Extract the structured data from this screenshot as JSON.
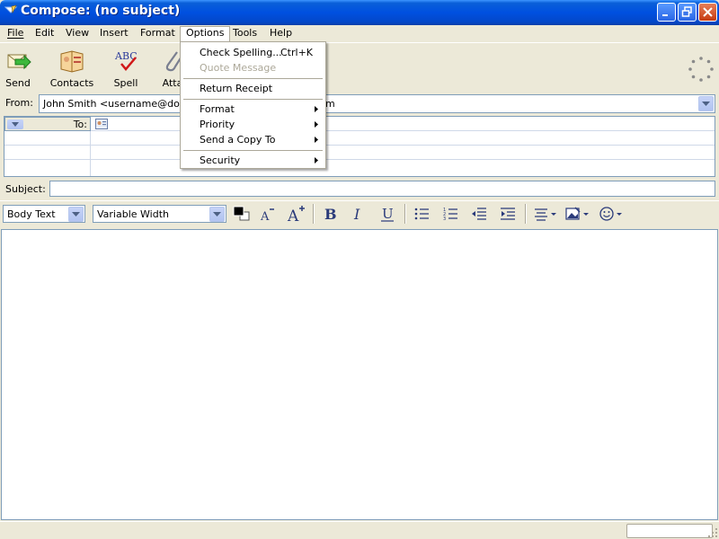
{
  "window": {
    "title": "Compose: (no subject)"
  },
  "menubar": {
    "items": [
      {
        "label": "File",
        "key": "F"
      },
      {
        "label": "Edit",
        "key": "E"
      },
      {
        "label": "View",
        "key": "V"
      },
      {
        "label": "Insert",
        "key": "I"
      },
      {
        "label": "Format",
        "key": "o"
      },
      {
        "label": "Options",
        "key": "p",
        "open": true
      },
      {
        "label": "Tools",
        "key": "T"
      },
      {
        "label": "Help",
        "key": "H"
      }
    ]
  },
  "toolbar": {
    "send_label": "Send",
    "contacts_label": "Contacts",
    "spell_label": "Spell",
    "attach_label": "Atta"
  },
  "options_menu": {
    "check_spelling": "Check Spelling...",
    "check_spelling_shortcut": "Ctrl+K",
    "quote_message": "Quote Message",
    "return_receipt": "Return Receipt",
    "format": "Format",
    "priority": "Priority",
    "send_copy_to": "Send a Copy To",
    "security": "Security"
  },
  "compose": {
    "from_label": "From:",
    "from_value": "John Smith <username@domain",
    "from_value_tail": "m",
    "to_label": "To:",
    "subject_label": "Subject:",
    "subject_value": ""
  },
  "format_toolbar": {
    "paragraph_style": "Body Text",
    "font_family": "Variable Width",
    "text_color": "#000000"
  },
  "status": {
    "text": ""
  },
  "colors": {
    "titlebar": "#0050e0",
    "chrome": "#ece9d8",
    "field_border": "#7f9db9",
    "disabled_text": "#aca899"
  }
}
